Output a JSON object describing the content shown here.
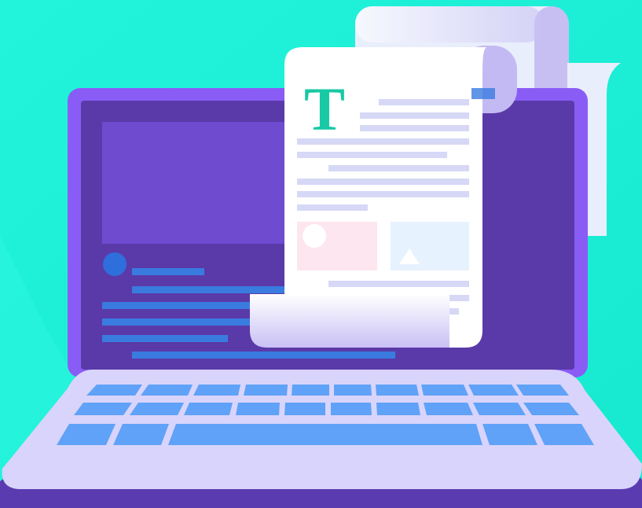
{
  "illustration": {
    "document_initial": "T"
  },
  "colors": {
    "background": "#1ef0d8",
    "laptop_frame": "#8a5cf6",
    "screen": "#5a3aa8",
    "screen_panel": "#6f4bd0",
    "screen_line": "#3a7be0",
    "keyboard_deck": "#d9d4fb",
    "keyboard_base": "#5b3bb0",
    "key": "#5fa2f8",
    "paper": "#ffffff",
    "paper_back": "#e9eefc",
    "paper_shadow": "#c4baf3",
    "paper_line": "#d6d8f6",
    "accent_teal": "#17c9a4",
    "pink_card": "#fde6ef",
    "blue_card": "#e7f2ff"
  }
}
